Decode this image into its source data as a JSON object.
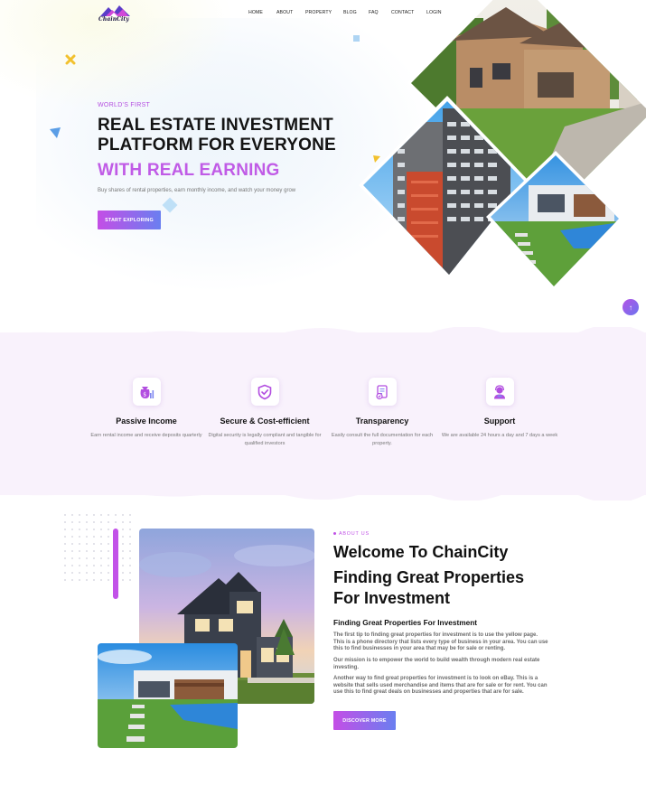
{
  "brand": {
    "name": "ChainCity"
  },
  "nav": {
    "items": [
      "HOME",
      "ABOUT",
      "PROPERTY",
      "BLOG",
      "FAQ",
      "CONTACT",
      "LOGIN"
    ]
  },
  "hero": {
    "kicker": "WORLD'S FIRST",
    "title_line1": "REAL ESTATE INVESTMENT",
    "title_line2": "PLATFORM FOR EVERYONE",
    "accent": "WITH REAL EARNING",
    "subtitle": "Buy shares of rental properties, earn monthly income, and watch your money grow",
    "cta": "START EXPLORING"
  },
  "scroll_top": {
    "icon": "arrow-up-icon",
    "glyph": "↑"
  },
  "features": [
    {
      "icon": "money-bag-icon",
      "title": "Passive Income",
      "desc": "Earn rental income and receive deposits quarterly"
    },
    {
      "icon": "shield-check-icon",
      "title": "Secure & Cost-efficient",
      "desc": "Digital security is legally compliant and tangible for qualified investors"
    },
    {
      "icon": "document-check-icon",
      "title": "Transparency",
      "desc": "Easily consult the full documentation for each property."
    },
    {
      "icon": "support-agent-icon",
      "title": "Support",
      "desc": "We are available 24 hours a day and 7 days a week"
    }
  ],
  "about": {
    "kicker": "ABOUT US",
    "heading": "Welcome To ChainCity",
    "subheading_line1": "Finding Great Properties",
    "subheading_line2": "For Investment",
    "title": "Finding Great Properties For Investment",
    "paragraphs": [
      "The first tip to finding great properties for investment is to use the yellow page. This is a phone directory that lists every type of business in your area. You can use this to find businesses in your area that may be for sale or renting.",
      "Our mission is to empower the world to build wealth through modern real estate investing.",
      "Another way to find great properties for investment is to look on eBay. This is a website that sells used merchandise and items that are for sale or for rent. You can use this to find great deals on businesses and properties that are for sale."
    ],
    "cta": "DISCOVER MORE"
  },
  "colors": {
    "accent": "#c05be6",
    "gradient_start": "#c44ee6",
    "gradient_end": "#6a7ff0",
    "band": "#f9f2fc"
  }
}
